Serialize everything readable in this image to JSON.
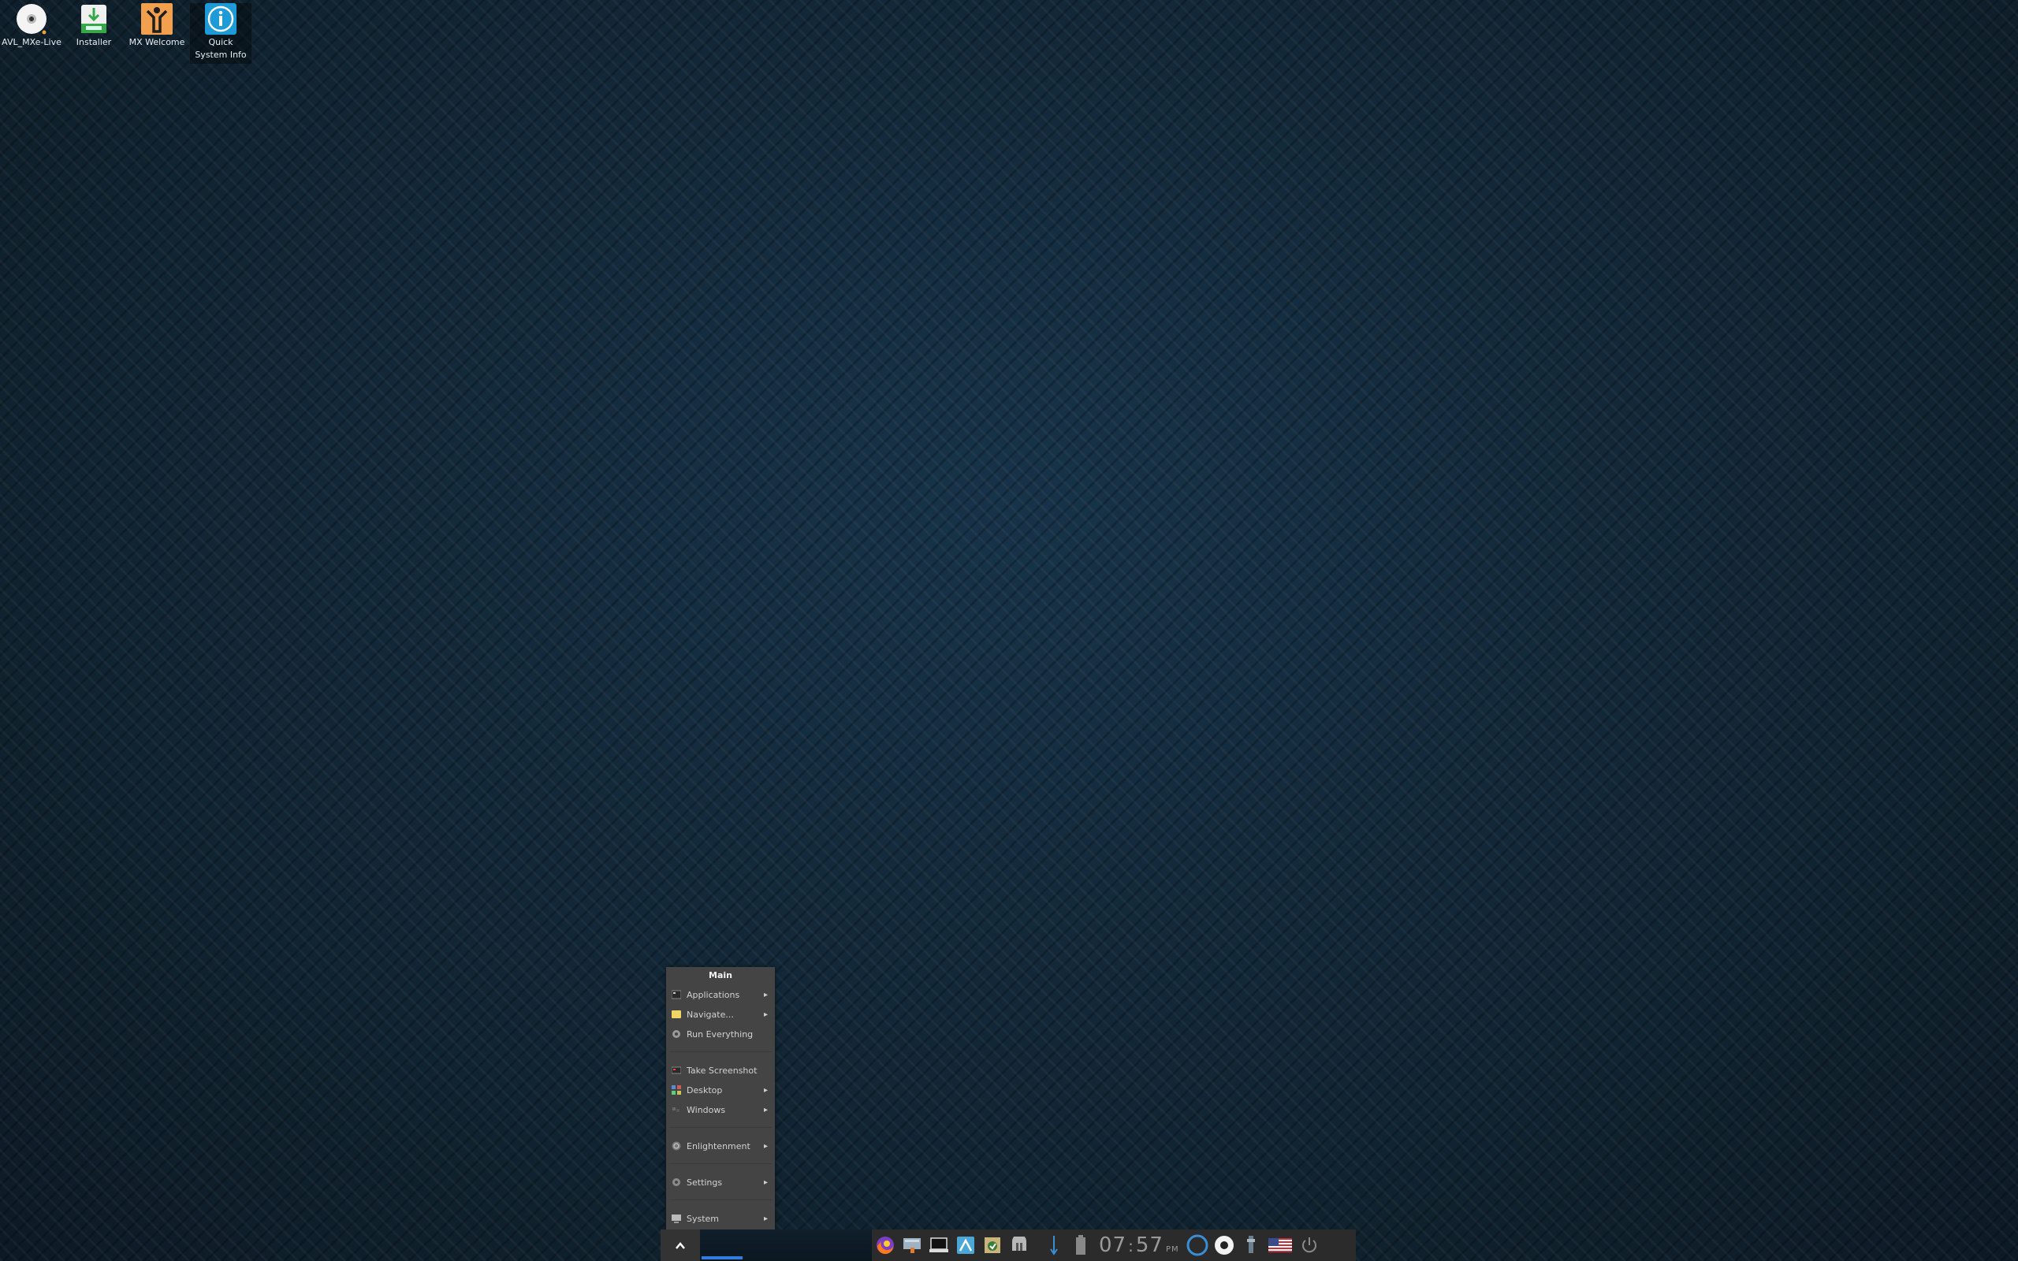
{
  "desktop": {
    "icons": [
      {
        "label": "AVL_MXe-Live",
        "icon": "disc-icon"
      },
      {
        "label": "Installer",
        "icon": "installer-icon"
      },
      {
        "label": "MX Welcome",
        "icon": "mx-welcome-icon"
      },
      {
        "label": "Quick System Info",
        "icon": "info-icon"
      }
    ]
  },
  "menu": {
    "title": "Main",
    "items": [
      {
        "label": "Applications",
        "icon": "applications-icon",
        "submenu": true
      },
      {
        "label": "Navigate...",
        "icon": "folder-icon",
        "submenu": true
      },
      {
        "label": "Run Everything",
        "icon": "gear-icon",
        "submenu": false
      },
      {
        "label": "Take Screenshot",
        "icon": "screenshot-icon",
        "submenu": false
      },
      {
        "label": "Desktop",
        "icon": "desktop-icon",
        "submenu": true
      },
      {
        "label": "Windows",
        "icon": "windows-icon",
        "submenu": true
      },
      {
        "label": "Enlightenment",
        "icon": "enlightenment-icon",
        "submenu": true
      },
      {
        "label": "Settings",
        "icon": "settings-icon",
        "submenu": true
      },
      {
        "label": "System",
        "icon": "system-icon",
        "submenu": true
      }
    ]
  },
  "shelf": {
    "start_icon": "chevron-up-icon",
    "tray_icons": [
      "firefox-icon",
      "file-manager-icon",
      "terminal-icon",
      "mx-tools-icon",
      "package-installer-icon",
      "updater-icon",
      "network-icon",
      "battery-icon"
    ],
    "clock": {
      "hours": "07",
      "minutes": "57",
      "ampm": "PM"
    },
    "tray_icons_right": [
      "circle-indicator-icon",
      "record-icon",
      "volume-icon",
      "us-flag-icon",
      "power-icon"
    ]
  },
  "colors": {
    "accent": "#2f7de0",
    "menu_bg": "#444444",
    "tray_bg": "#2b2b2b"
  }
}
